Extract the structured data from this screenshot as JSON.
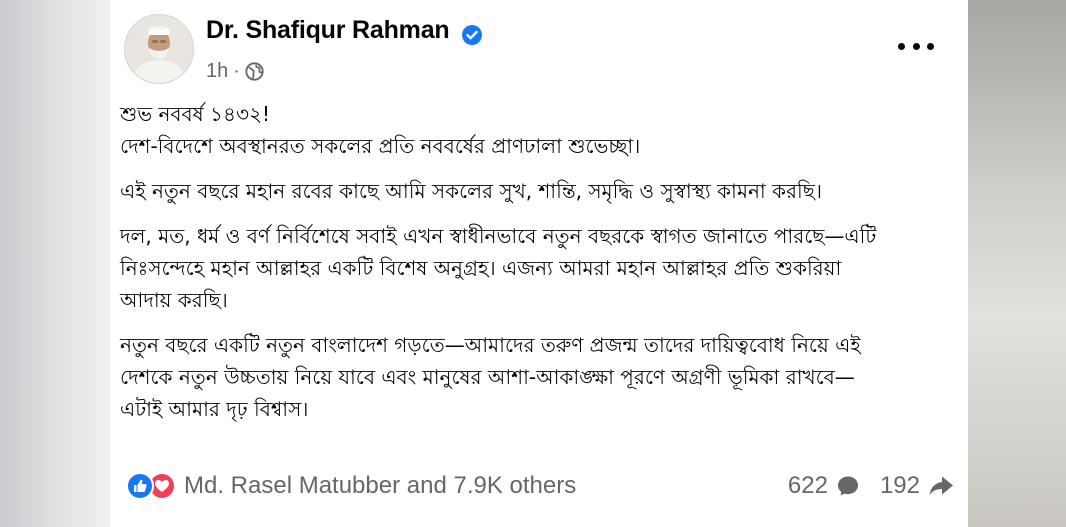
{
  "post": {
    "author": "Dr. Shafiqur Rahman",
    "time": "1h",
    "separator": "·",
    "paragraphs": [
      [
        "শুভ নববর্ষ ১৪৩২!",
        "দেশ-বিদেশে অবস্থানরত সকলের প্রতি নববর্ষের প্রাণঢালা শুভেচ্ছা।"
      ],
      [
        "এই নতুন বছরে মহান রবের কাছে আমি সকলের সুখ, শান্তি, সমৃদ্ধি ও সুস্বাস্থ্য কামনা করছি।"
      ],
      [
        "দল, মত, ধর্ম ও বর্ণ নির্বিশেষে সবাই এখন স্বাধীনভাবে নতুন বছরকে স্বাগত জানাতে পারছে—এটি",
        "নিঃসন্দেহে মহান আল্লাহর একটি বিশেষ অনুগ্রহ। এজন্য আমরা মহান আল্লাহর প্রতি শুকরিয়া",
        "আদায় করছি।"
      ],
      [
        "নতুন বছরে একটি নতুন বাংলাদেশ গড়তে—আমাদের তরুণ প্রজন্ম তাদের দায়িত্ববোধ নিয়ে এই",
        "দেশকে নতুন উচ্চতায় নিয়ে যাবে এবং মানুষের আশা-আকাঙ্ক্ষা পূরণে অগ্রণী ভূমিকা রাখবে—",
        "এটাই আমার দৃঢ় বিশ্বাস।"
      ]
    ]
  },
  "reactions": {
    "icons": [
      "like-icon",
      "love-icon"
    ],
    "names": "Md. Rasel Matubber and 7.9K others",
    "comments": "622",
    "shares": "192"
  },
  "colors": {
    "accent": "#1877f2",
    "love": "#f33e58",
    "secondary_text": "#65676b",
    "primary_text": "#050505"
  }
}
